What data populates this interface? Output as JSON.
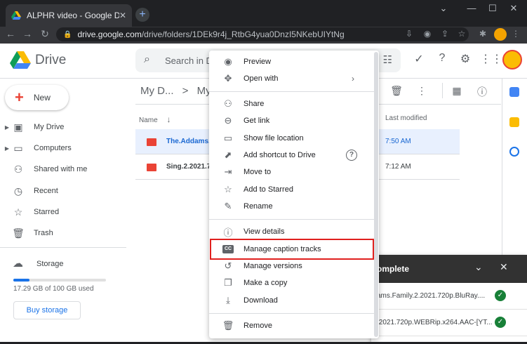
{
  "browser": {
    "tab_title": "ALPHR video - Google Drive",
    "tab_close": "✕",
    "new_tab": "+",
    "url_host": "drive.google.com",
    "url_path": "/drive/folders/1DEk9r4j_RtbG4yua0DnzI5NKebUIYtNg",
    "window_controls": [
      "⌄",
      "—",
      "☐",
      "✕"
    ]
  },
  "drive": {
    "logo_text": "Drive",
    "search_placeholder": "Search in Dr",
    "new_label": "New",
    "nav": [
      {
        "label": "My Drive",
        "icon": "my-drive-icon",
        "has_caret": true
      },
      {
        "label": "Computers",
        "icon": "computers-icon",
        "has_caret": true
      },
      {
        "label": "Shared with me",
        "icon": "shared-icon",
        "has_caret": false
      },
      {
        "label": "Recent",
        "icon": "recent-icon",
        "has_caret": false
      },
      {
        "label": "Starred",
        "icon": "star-icon",
        "has_caret": false
      },
      {
        "label": "Trash",
        "icon": "trash-icon",
        "has_caret": false
      }
    ],
    "storage_label": "Storage",
    "storage_used_text": "17.29 GB of 100 GB used",
    "storage_fraction": 0.1729,
    "buy_storage": "Buy storage",
    "breadcrumb": [
      "My D...",
      ">",
      "My ..."
    ],
    "columns": {
      "name": "Name",
      "sort": "↓",
      "modified": "Last modified"
    },
    "files": [
      {
        "name": "The.Addams.I",
        "modified": "7:50 AM",
        "selected": true
      },
      {
        "name": "Sing.2.2021.7",
        "modified": "7:12 AM",
        "selected": false
      }
    ]
  },
  "menu": {
    "items": [
      {
        "label": "Preview",
        "icon": "eye-icon",
        "glyph": "◉"
      },
      {
        "label": "Open with",
        "icon": "open-with-icon",
        "glyph": "✥",
        "submenu": "›"
      },
      {
        "label": "Share",
        "icon": "share-person-icon",
        "glyph": "⚇"
      },
      {
        "label": "Get link",
        "icon": "link-icon",
        "glyph": "⊖"
      },
      {
        "label": "Show file location",
        "icon": "folder-icon",
        "glyph": "▭"
      },
      {
        "label": "Add shortcut to Drive",
        "icon": "shortcut-icon",
        "glyph": "⬈",
        "help": "?"
      },
      {
        "label": "Move to",
        "icon": "move-to-icon",
        "glyph": "⇥"
      },
      {
        "label": "Add to Starred",
        "icon": "star-outline-icon",
        "glyph": "☆"
      },
      {
        "label": "Rename",
        "icon": "pencil-icon",
        "glyph": "✎"
      },
      {
        "label": "View details",
        "icon": "info-icon",
        "glyph": "ⓘ"
      },
      {
        "label": "Manage caption tracks",
        "icon": "caption-icon",
        "glyph": "CC"
      },
      {
        "label": "Manage versions",
        "icon": "history-icon",
        "glyph": "↺"
      },
      {
        "label": "Make a copy",
        "icon": "copy-icon",
        "glyph": "❐"
      },
      {
        "label": "Download",
        "icon": "download-icon",
        "glyph": "⤓"
      },
      {
        "label": "Remove",
        "icon": "trash-icon",
        "glyph": "🗑"
      }
    ],
    "highlight_color": "#e0201e"
  },
  "upload": {
    "title": "omplete",
    "rows": [
      "ams.Family.2.2021.720p.BluRay....",
      ".2021.720p.WEBRip.x264.AAC-[YT..."
    ],
    "ok_glyph": "✓"
  },
  "colors": {
    "accent": "#1a73e8",
    "selected_row": "#e8f0fe",
    "file_icon": "#ea4335"
  }
}
